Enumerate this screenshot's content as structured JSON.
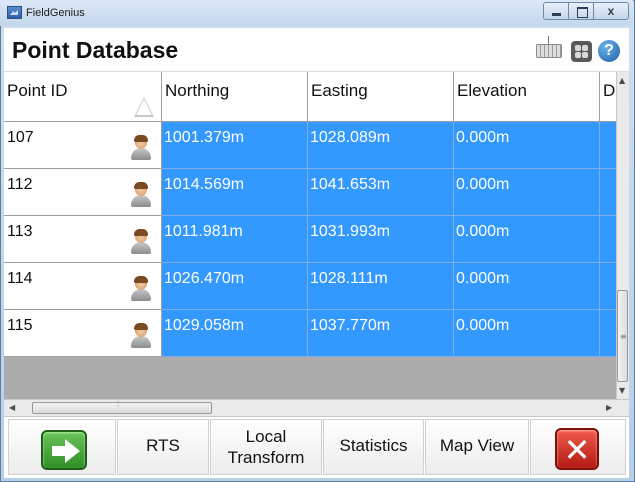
{
  "window": {
    "app_title": "FieldGenius"
  },
  "header": {
    "title": "Point Database"
  },
  "table": {
    "columns": [
      "Point ID",
      "Northing",
      "Easting",
      "Elevation",
      "D"
    ],
    "rows": [
      {
        "id": "107",
        "northing": "1001.379m",
        "easting": "1028.089m",
        "elevation": "0.000m"
      },
      {
        "id": "112",
        "northing": "1014.569m",
        "easting": "1041.653m",
        "elevation": "0.000m"
      },
      {
        "id": "113",
        "northing": "1011.981m",
        "easting": "1031.993m",
        "elevation": "0.000m"
      },
      {
        "id": "114",
        "northing": "1026.470m",
        "easting": "1028.111m",
        "elevation": "0.000m"
      },
      {
        "id": "115",
        "northing": "1029.058m",
        "easting": "1037.770m",
        "elevation": "0.000m"
      }
    ]
  },
  "toolbar": {
    "rts_label": "RTS",
    "local_transform_line1": "Local",
    "local_transform_line2": "Transform",
    "statistics_label": "Statistics",
    "map_view_label": "Map View"
  },
  "icons": {
    "ok": "green-arrow-right-icon",
    "cancel": "red-x-icon",
    "point_type": "person-icon"
  },
  "colors": {
    "selection": "#3399ff",
    "header_bg": "#ffffff"
  }
}
